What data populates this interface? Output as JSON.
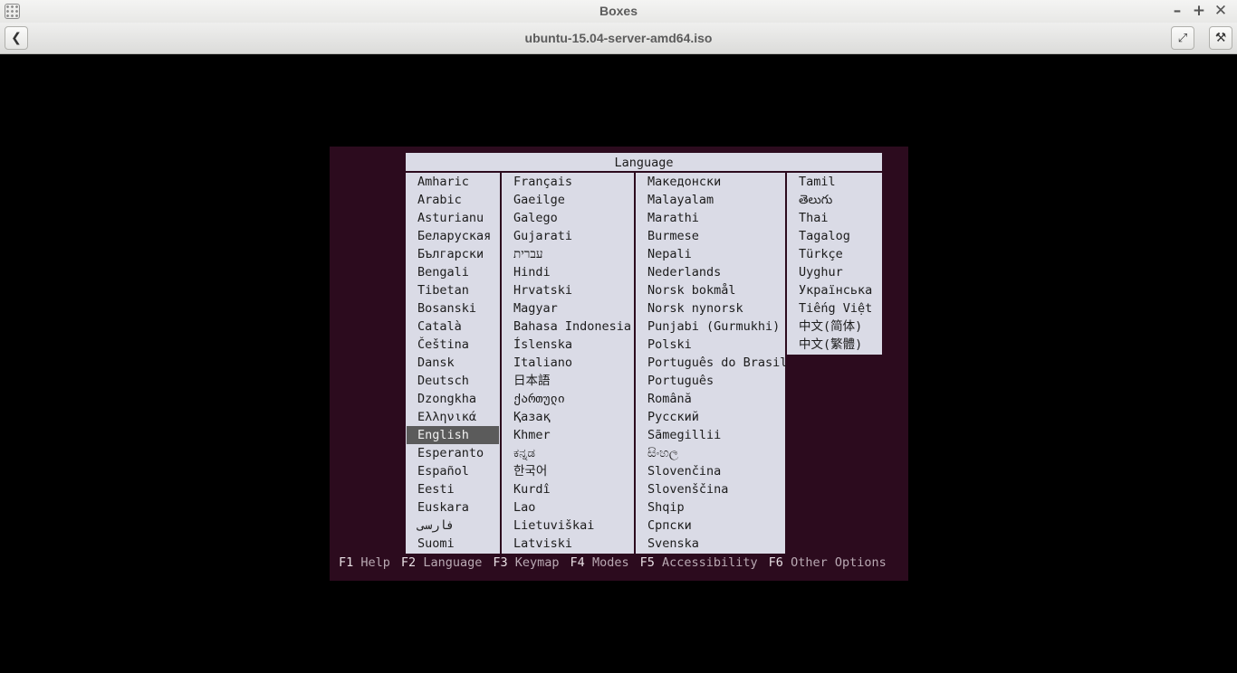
{
  "window": {
    "title": "Boxes",
    "subtitle": "ubuntu-15.04-server-amd64.iso",
    "buttons": {
      "minimize": "–",
      "maximize": "+",
      "close": "✕"
    }
  },
  "installer": {
    "dialog_title": "Language",
    "selected": "English",
    "columns": [
      [
        "Amharic",
        "Arabic",
        "Asturianu",
        "Беларуская",
        "Български",
        "Bengali",
        "Tibetan",
        "Bosanski",
        "Català",
        "Čeština",
        "Dansk",
        "Deutsch",
        "Dzongkha",
        "Ελληνικά",
        "English",
        "Esperanto",
        "Español",
        "Eesti",
        "Euskara",
        "فارسی",
        "Suomi"
      ],
      [
        "Français",
        "Gaeilge",
        "Galego",
        "Gujarati",
        "עברית",
        "Hindi",
        "Hrvatski",
        "Magyar",
        "Bahasa Indonesia",
        "Íslenska",
        "Italiano",
        "日本語",
        "ქართული",
        "Қазақ",
        "Khmer",
        "ಕನ್ನಡ",
        "한국어",
        "Kurdî",
        "Lao",
        "Lietuviškai",
        "Latviski"
      ],
      [
        "Македонски",
        "Malayalam",
        "Marathi",
        "Burmese",
        "Nepali",
        "Nederlands",
        "Norsk bokmål",
        "Norsk nynorsk",
        "Punjabi (Gurmukhi)",
        "Polski",
        "Português do Brasil",
        "Português",
        "Română",
        "Русский",
        "Sãmegillii",
        "සිංහල",
        "Slovenčina",
        "Slovenščina",
        "Shqip",
        "Српски",
        "Svenska"
      ],
      [
        "Tamil",
        "తెలుగు",
        "Thai",
        "Tagalog",
        "Türkçe",
        "Uyghur",
        "Українська",
        "Tiếng Việt",
        "中文(简体)",
        "中文(繁體)"
      ]
    ],
    "fkeys": [
      {
        "key": "F1",
        "label": "Help"
      },
      {
        "key": "F2",
        "label": "Language"
      },
      {
        "key": "F3",
        "label": "Keymap"
      },
      {
        "key": "F4",
        "label": "Modes"
      },
      {
        "key": "F5",
        "label": "Accessibility"
      },
      {
        "key": "F6",
        "label": "Other Options"
      }
    ]
  },
  "colors": {
    "installer_bg": "#2c0b1e",
    "dialog_bg": "#dadbe6",
    "selection_bg": "#5b5b5b"
  },
  "icons": [
    "app-menu-icon",
    "back-arrow-icon",
    "fullscreen-icon",
    "tools-icon"
  ]
}
